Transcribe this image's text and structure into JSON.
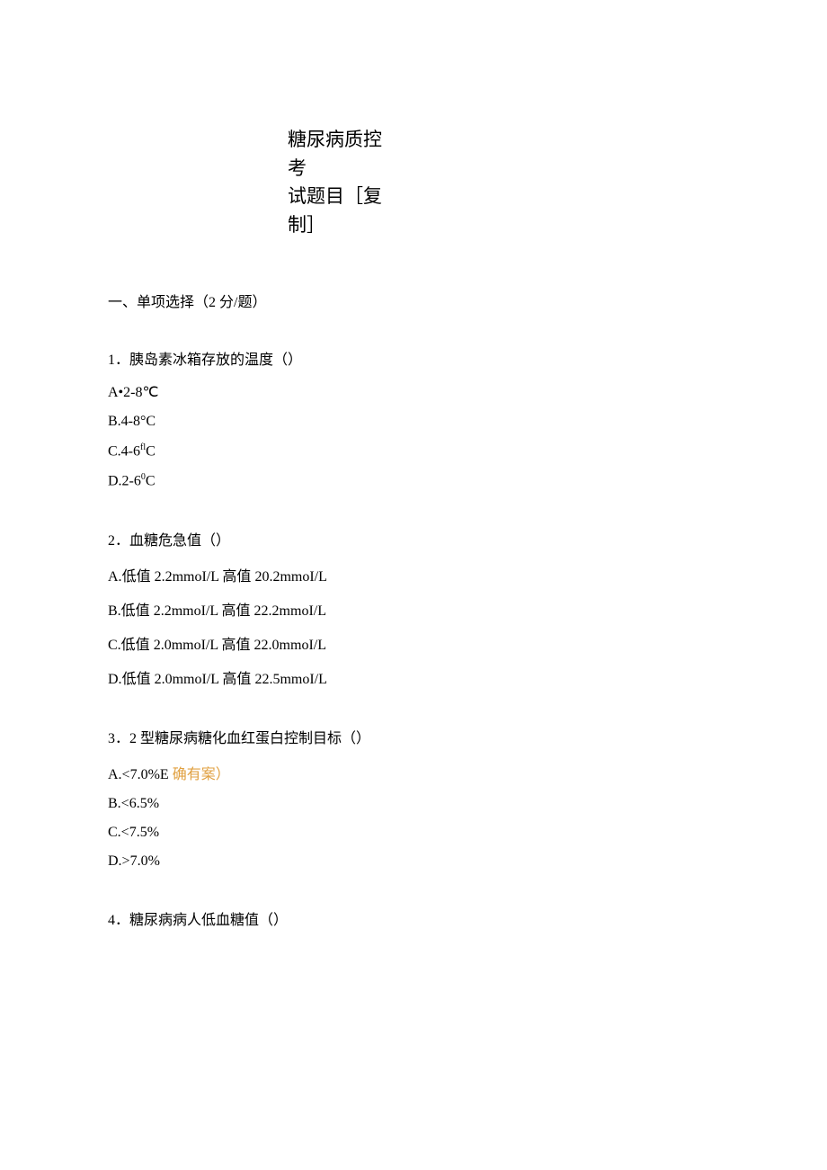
{
  "title_line1": "糖尿病质控考",
  "title_line2": "试题目［复",
  "title_line3": "制］",
  "section_heading": "一、单项选择（2 分/题）",
  "q1": {
    "num": "1",
    "stem": "．胰岛素冰箱存放的温度（）",
    "optA": "A•2-8℃",
    "optB": "B.4-8°C",
    "optC_prefix": "C.4-6",
    "optC_sup": "fl",
    "optC_suffix": "C",
    "optD_prefix": "D.2-6",
    "optD_sup": "0",
    "optD_suffix": "C"
  },
  "q2": {
    "num": "2",
    "stem": "．血糖危急值（）",
    "optA_prefix": "A.",
    "optA_low_label": "低值",
    "optA_low_val": " 2.2mmoI/L ",
    "optA_high_label": "高值",
    "optA_high_val": " 20.2mmoI/L",
    "optB_prefix": "B.",
    "optB_low_label": "低值",
    "optB_low_val": " 2.2mmoI/L ",
    "optB_high_label": "高值",
    "optB_high_val": " 22.2mmoI/L",
    "optC_prefix": "C.",
    "optC_low_label": "低值",
    "optC_low_val": " 2.0mmoI/L ",
    "optC_high_label": "高值",
    "optC_high_val": " 22.0mmoI/L",
    "optD_prefix": "D.",
    "optD_low_label": "低值",
    "optD_low_val": " 2.0mmoI/L ",
    "optD_high_label": "高值",
    "optD_high_val": " 22.5mmoI/L"
  },
  "q3": {
    "num": "3",
    "stem": "．2 型糖尿病糖化血红蛋白控制目标（）",
    "optA_prefix": "A.<7.0%E ",
    "optA_annot": "确有案）",
    "optB": "B.<6.5%",
    "optC": "C.<7.5%",
    "optD": "D.>7.0%"
  },
  "q4": {
    "num": "4",
    "stem": "．糖尿病病人低血糖值（）"
  }
}
